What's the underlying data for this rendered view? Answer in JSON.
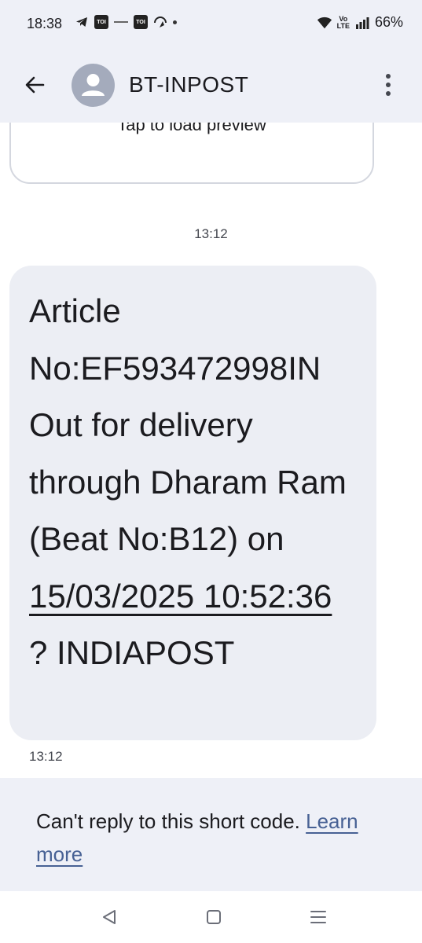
{
  "status_bar": {
    "time": "18:38",
    "battery": "66%",
    "network_label_top": "Vo",
    "network_label_bottom": "LTE",
    "left_icons": [
      "telegram-icon",
      "toi-icon",
      "app-icon",
      "toi-icon",
      "nav-arrow-icon"
    ],
    "right_icons": [
      "wifi-icon",
      "signal-icon"
    ]
  },
  "header": {
    "contact_name": "BT-INPOST",
    "icons": [
      "back-arrow-icon",
      "avatar-icon",
      "more-vert-icon"
    ]
  },
  "conversation": {
    "preview": {
      "label": "Tap to load preview"
    },
    "timestamp_top": "13:12",
    "message": {
      "text_before_link": "Article No:EF593472998IN Out for delivery through Dharam Ram (Beat No:B12) on ",
      "link_text": "15/03/2025 10:52:36",
      "text_after_link": " ? INDIAPOST",
      "timestamp": "13:12"
    }
  },
  "reply_notice": {
    "text": "Can't reply to this short code. ",
    "link_label": "Learn more"
  },
  "nav_bar": {
    "icons": [
      "back-triangle-icon",
      "home-square-icon",
      "recents-menu-icon"
    ]
  },
  "colors": {
    "header_bg": "#eef0f7",
    "bubble_bg": "#eceef4",
    "link": "#476194",
    "avatar": "#a4abbc"
  }
}
